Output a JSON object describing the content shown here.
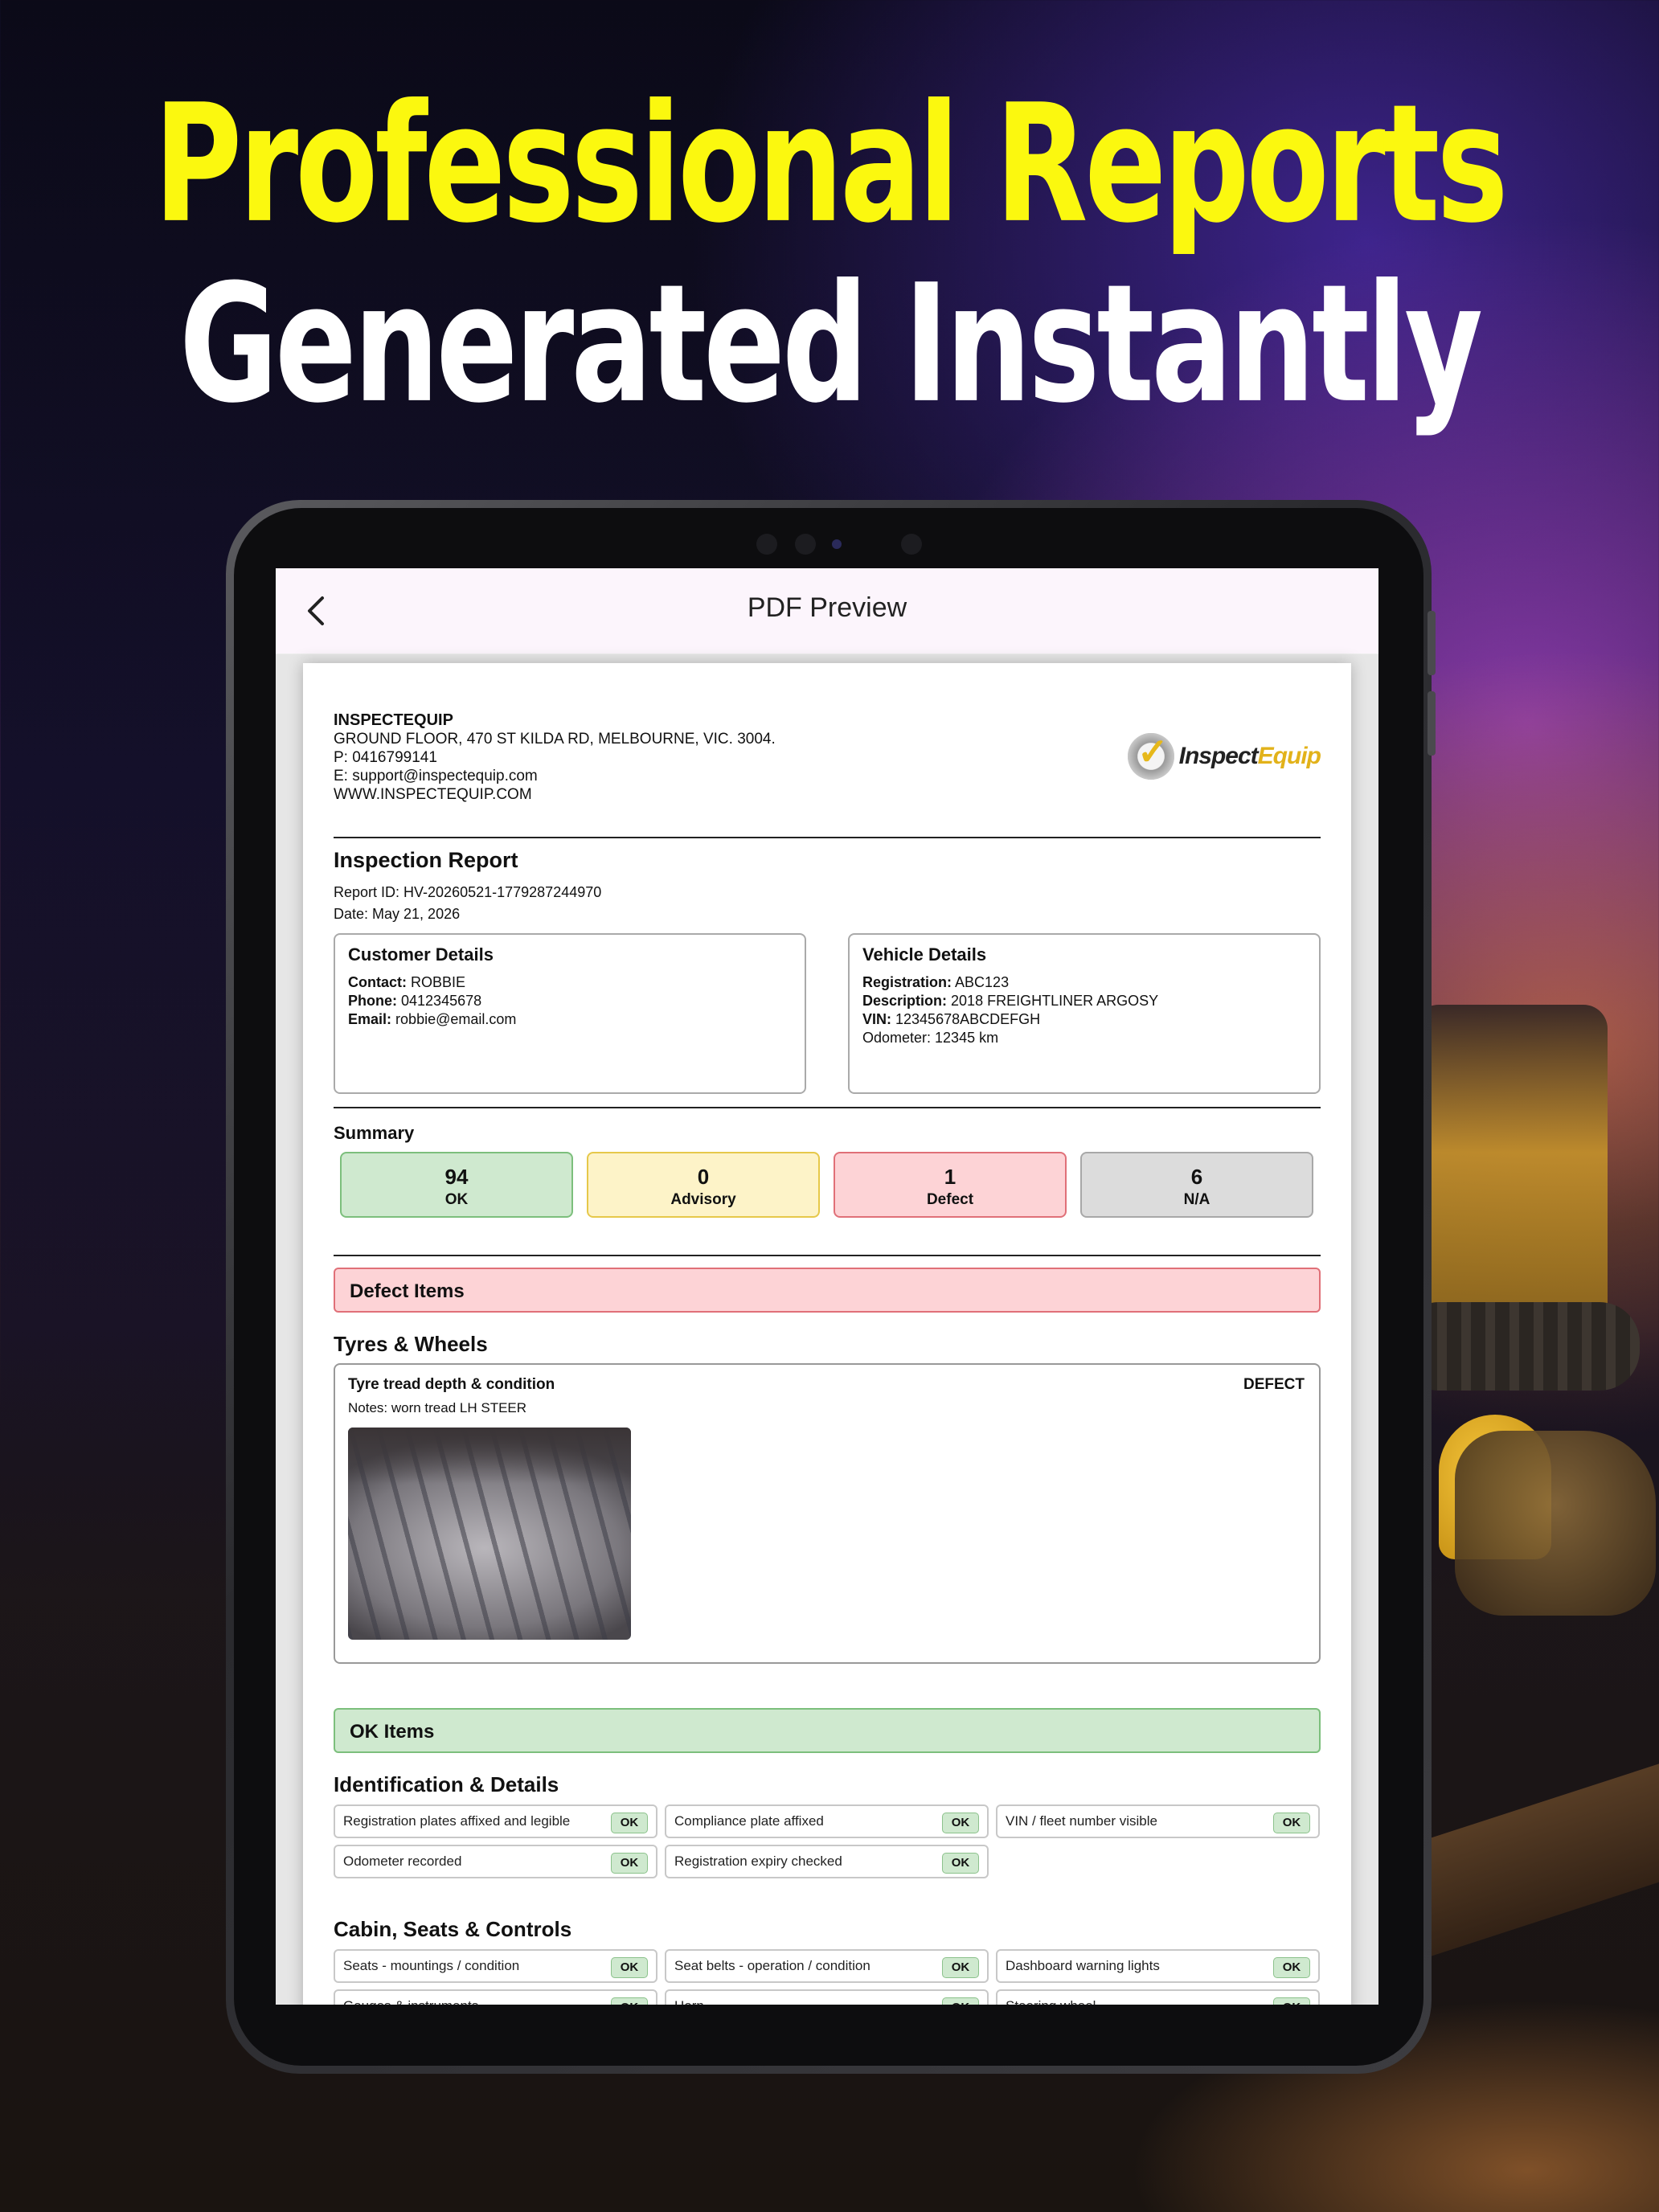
{
  "hero": {
    "line1": "Professional Reports",
    "line2": "Generated Instantly",
    "line1_color": "#fbf80f",
    "line2_color": "#ffffff"
  },
  "app_bar": {
    "back_icon": "‹",
    "title": "PDF Preview"
  },
  "company": {
    "name": "INSPECTEQUIP",
    "address": "GROUND FLOOR, 470 ST KILDA RD, MELBOURNE, VIC. 3004.",
    "phone": "P: 0416799141",
    "email": "E: support@inspectequip.com",
    "website": "WWW.INSPECTEQUIP.COM",
    "logo_text_a": "Inspect",
    "logo_text_b": "Equip"
  },
  "report": {
    "title": "Inspection Report",
    "report_id": "Report ID: HV-20260521-1779287244970",
    "date": "Date: May 21, 2026"
  },
  "customer": {
    "heading": "Customer Details",
    "contact_label": "Contact:",
    "contact": "ROBBIE",
    "phone_label": "Phone:",
    "phone": "0412345678",
    "email_label": "Email:",
    "email": "robbie@email.com"
  },
  "vehicle": {
    "heading": "Vehicle Details",
    "registration_label": "Registration:",
    "registration": "ABC123",
    "description_label": "Description:",
    "description": "2018 FREIGHTLINER ARGOSY",
    "vin_label": "VIN:",
    "vin": "12345678ABCDEFGH",
    "odometer": "Odometer: 12345 km"
  },
  "summary": {
    "label": "Summary",
    "cards": [
      {
        "count": "94",
        "label": "OK",
        "bg": "#cfe9cf",
        "border": "#7cbf7c"
      },
      {
        "count": "0",
        "label": "Advisory",
        "bg": "#fdf3c8",
        "border": "#e6c84a"
      },
      {
        "count": "1",
        "label": "Defect",
        "bg": "#fdd3d6",
        "border": "#e07078"
      },
      {
        "count": "6",
        "label": "N/A",
        "bg": "#dcdcdc",
        "border": "#a8a8a8"
      }
    ]
  },
  "defects": {
    "band_label": "Defect Items",
    "band_bg": "#fdd3d6",
    "band_border": "#e07078",
    "section": "Tyres & Wheels",
    "item": "Tyre tread depth & condition",
    "status": "DEFECT",
    "notes": "Notes: worn tread LH STEER"
  },
  "ok_items": {
    "band_label": "OK Items",
    "band_bg": "#cfe9cf",
    "band_border": "#7cbf7c",
    "badge": "OK",
    "sections": [
      {
        "title": "Identification & Details",
        "rows": [
          [
            "Registration plates affixed and legible",
            "Compliance plate affixed",
            "VIN / fleet number visible"
          ],
          [
            "Odometer recorded",
            "Registration expiry checked"
          ]
        ]
      },
      {
        "title": "Cabin, Seats & Controls",
        "rows": [
          [
            "Seats - mountings / condition",
            "Seat belts - operation / condition",
            "Dashboard warning lights"
          ],
          [
            "Gauges & instruments",
            "Horn",
            "Steering wheel"
          ]
        ]
      }
    ]
  }
}
